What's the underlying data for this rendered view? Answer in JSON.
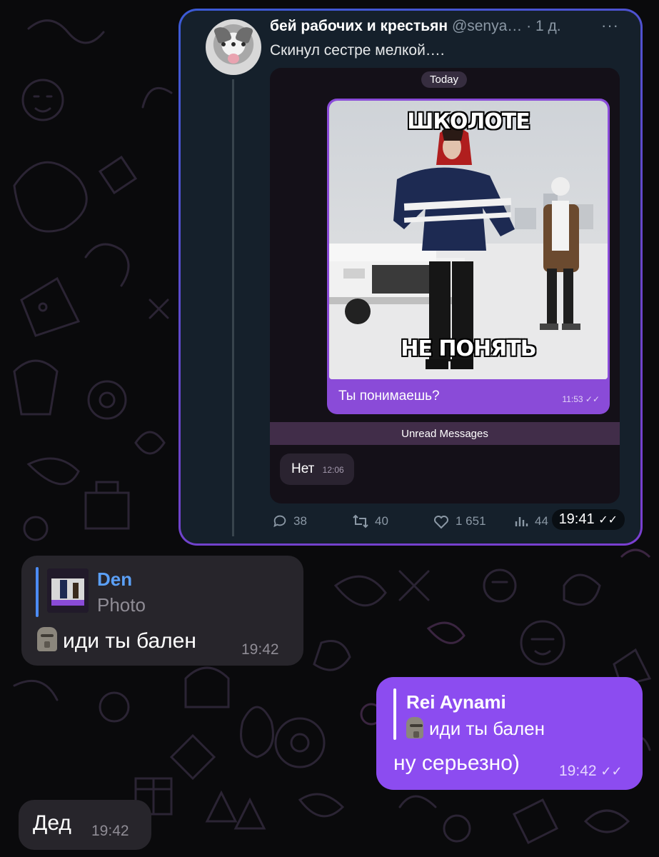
{
  "tweet": {
    "author": "бей рабочих и крестьян",
    "handle": "@senya…",
    "age": "· 1 д.",
    "more_icon": "more-horizontal-icon",
    "text": "Скинул сестре мелкой….",
    "inner_chat": {
      "date_pill": "Today",
      "meme_top_text": "ШКОЛОТЕ",
      "meme_bottom_text": "НЕ ПОНЯТЬ",
      "caption": "Ты понимаешь?",
      "caption_time": "11:53",
      "unread_divider": "Unread Messages",
      "reply_text": "Нет",
      "reply_time": "12:06"
    },
    "actions": {
      "replies": "38",
      "retweets": "40",
      "likes": "1 651",
      "views": "44"
    },
    "forward_time": "19:41"
  },
  "messages": [
    {
      "direction": "incoming",
      "reply_to_author": "Den",
      "reply_to_preview": "Photo",
      "emoji_icon": "moai-icon",
      "text": "иди ты бален",
      "time": "19:42"
    },
    {
      "direction": "outgoing",
      "reply_to_author": "Rei Aynami",
      "reply_to_preview": "иди ты бален",
      "emoji_icon": "moai-icon",
      "text": "ну серьезно)",
      "time": "19:42",
      "status": "read"
    },
    {
      "direction": "incoming",
      "text": "Дед",
      "time": "19:42"
    }
  ],
  "colors": {
    "outgoing_bubble": "#8c4cf0",
    "incoming_bubble": "#27252b",
    "reply_accent": "#5ba0f7",
    "tweet_background": "#15202b"
  }
}
